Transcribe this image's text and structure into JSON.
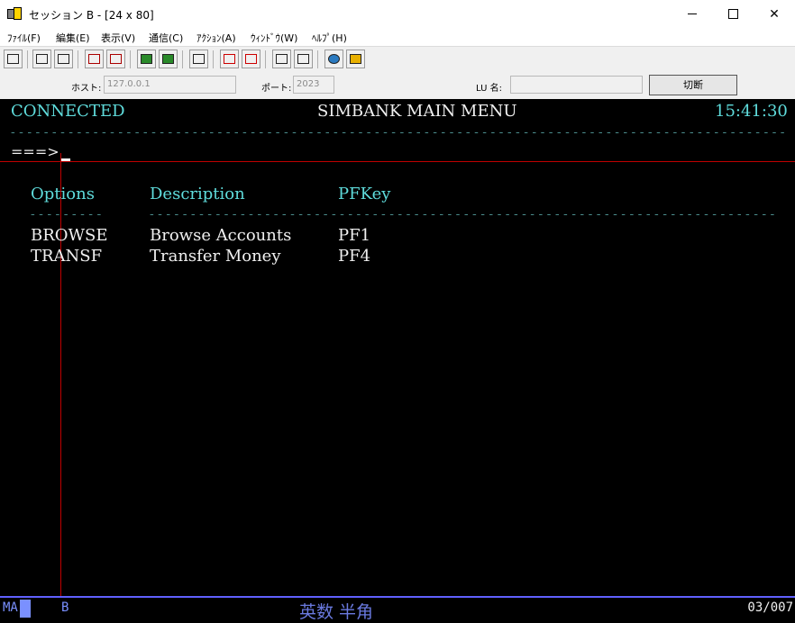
{
  "window": {
    "title": "セッション B - [24 x 80]",
    "controls": {
      "minimize": "—",
      "maximize": "□",
      "close": "✕"
    }
  },
  "menu": [
    {
      "label": "ﾌｧｲﾙ(F)"
    },
    {
      "label": "編集(E)"
    },
    {
      "label": "表示(V)"
    },
    {
      "label": "通信(C)"
    },
    {
      "label": "ｱｸｼｮﾝ(A)"
    },
    {
      "label": "ｳｨﾝﾄﾞｳ(W)"
    },
    {
      "label": "ﾍﾙﾌﾟ(H)"
    }
  ],
  "toolbar": {
    "icons": [
      "print-screen-icon",
      "copy-icon",
      "paste-icon",
      "send-file-icon",
      "receive-file-icon",
      "display-setup-icon",
      "keyboard-map-icon",
      "macro-icon",
      "record-macro-icon",
      "play-macro-icon",
      "stop-macro-icon",
      "run-macro-icon",
      "globe-icon",
      "help-icon"
    ]
  },
  "connection": {
    "host_label": "ホスト:",
    "host_value": "127.0.0.1",
    "port_label": "ポート:",
    "port_value": "2023",
    "lu_label": "LU 名:",
    "lu_value": "",
    "disconnect_label": "切断"
  },
  "screen": {
    "status": "CONNECTED",
    "title": "SIMBANK MAIN MENU",
    "time": "15:41:30",
    "prompt": "===>",
    "headers": {
      "options": "Options",
      "description": "Description",
      "pfkey": "PFKey"
    },
    "rows": [
      {
        "option": "BROWSE",
        "description": "Browse Accounts",
        "pfkey": "PF1"
      },
      {
        "option": "TRANSF",
        "description": "Transfer Money",
        "pfkey": "PF4"
      }
    ]
  },
  "statusbar": {
    "mode": "MA",
    "session": "B",
    "ime": "英数 半角",
    "cursor_pos": "03/007"
  },
  "colors": {
    "cyan": "#5fdcdc",
    "white": "#f0f0f0",
    "red_guide": "#c00000",
    "status_blue": "#7a90ff"
  }
}
